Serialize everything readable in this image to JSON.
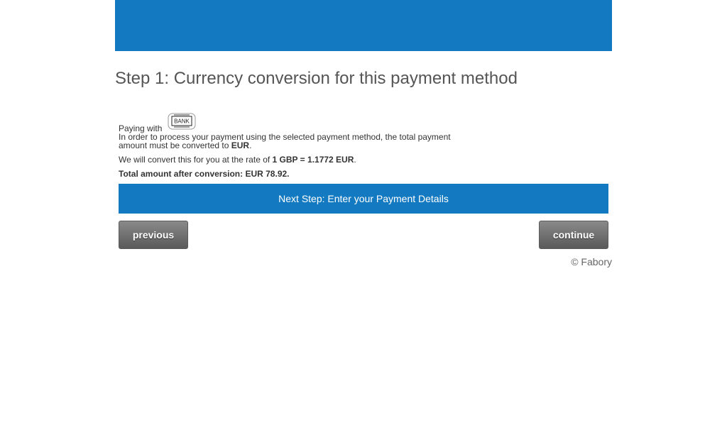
{
  "colors": {
    "brand_blue": "#137ac2",
    "button_gray": "#6b6b6b"
  },
  "header": {
    "title": "Step 1: Currency conversion for this payment method"
  },
  "payment": {
    "paying_with_label": "Paying with",
    "method_icon": "bank-icon",
    "method_icon_text": "BANK",
    "conversion_notice_prefix": "In order to process your payment using the selected payment method, the total payment amount must be converted to ",
    "target_currency": "EUR",
    "conversion_notice_suffix": ".",
    "rate_prefix": "We will convert this for you at the rate of ",
    "rate_value": "1 GBP = 1.1772 EUR",
    "rate_suffix": ".",
    "total_label": "Total amount after conversion: EUR 78.92."
  },
  "next_step": {
    "label": "Next Step: Enter your Payment Details"
  },
  "buttons": {
    "previous_label": "previous",
    "continue_label": "continue"
  },
  "footer": {
    "copyright": "© Fabory"
  }
}
